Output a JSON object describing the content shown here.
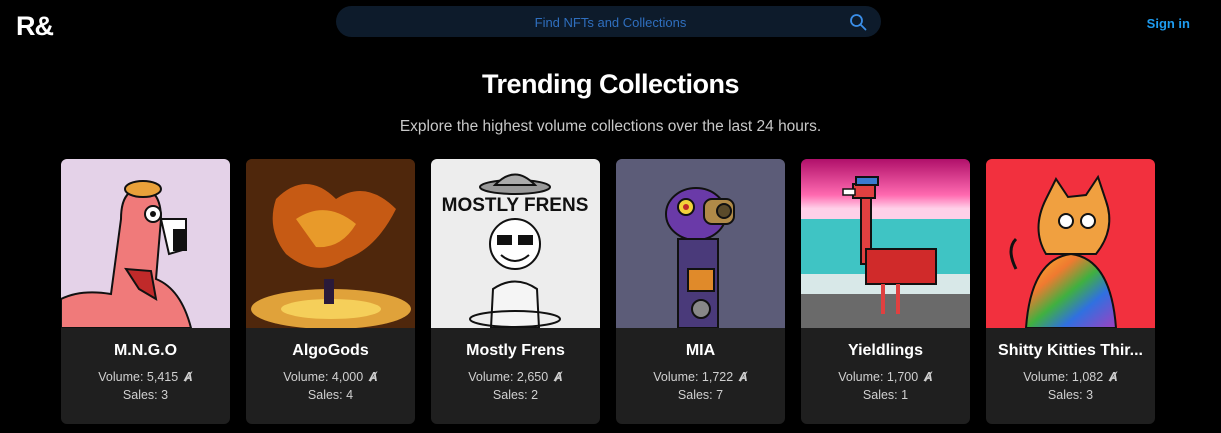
{
  "header": {
    "logo": "R&",
    "search_placeholder": "Find NFTs and Collections",
    "signin_label": "Sign in"
  },
  "main": {
    "title": "Trending Collections",
    "subtitle": "Explore the highest volume collections over the last 24 hours."
  },
  "currency_symbol": "Ⱥ",
  "collections": [
    {
      "name": "M.N.G.O",
      "volume": "Volume: 5,415",
      "sales": "Sales: 3",
      "bg": "#e4d2e8"
    },
    {
      "name": "AlgoGods",
      "volume": "Volume: 4,000",
      "sales": "Sales: 4",
      "bg": "#3a1d0b"
    },
    {
      "name": "Mostly Frens",
      "volume": "Volume: 2,650",
      "sales": "Sales: 2",
      "bg": "#ededed",
      "art_text": "MOSTLY FRENS"
    },
    {
      "name": "MIA",
      "volume": "Volume: 1,722",
      "sales": "Sales: 7",
      "bg": "#5c5c78"
    },
    {
      "name": "Yieldlings",
      "volume": "Volume: 1,700",
      "sales": "Sales: 1",
      "bg": "#e12f8e"
    },
    {
      "name": "Shitty Kitties Thir...",
      "volume": "Volume: 1,082",
      "sales": "Sales: 3",
      "bg": "#f2303e"
    }
  ]
}
